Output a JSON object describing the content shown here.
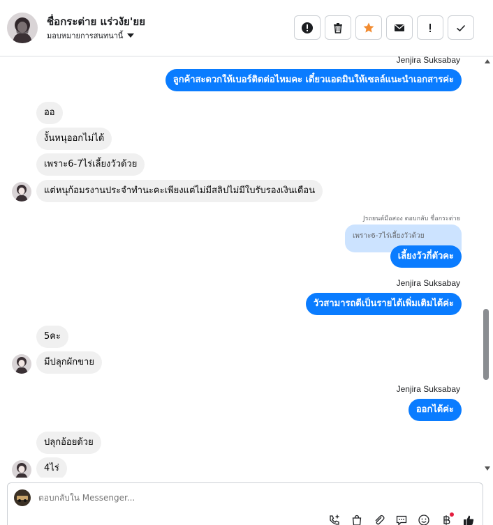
{
  "header": {
    "contact_name": "ชื่อกระต่าย แร่วงัย'ยย",
    "assign_label": "มอบหมายการสนทนานี้",
    "toolbar": [
      {
        "name": "mark-spam-button",
        "icon": "alert-circle-icon"
      },
      {
        "name": "delete-button",
        "icon": "trash-icon"
      },
      {
        "name": "star-button",
        "icon": "star-icon"
      },
      {
        "name": "mark-unread-button",
        "icon": "envelope-icon"
      },
      {
        "name": "follow-up-button",
        "icon": "exclamation-icon"
      },
      {
        "name": "mark-done-button",
        "icon": "check-icon"
      }
    ]
  },
  "messages": {
    "sender_name": "Jenjira Suksabay",
    "out1": "ลูกค้าสะดวกให้เบอร์ติดต่อไหมคะ เดี๋ยวแอดมินให้เซลล์แนะนำเอกสารค่ะ",
    "in1": "ออ",
    "in2": "งั้นหนุออกไม่ได้",
    "in3": "เพราะ6-7ไร่เลี้ยงวัวด้วย",
    "in4": "แต่หนุก้อมรงานประจำทำนะคะเพียงแต่ไม่มีสลิปไม่มีใบรับรองเงินเดือน",
    "reply_meta": "Jรถยนต์มือสอง ตอบกลับ ชื่อกระต่าย",
    "reply_quote": "เพราะ6-7ไร่เลี้ยงวัวด้วย",
    "out2": "เลี้ยงวัวกี่ตัวคะ",
    "out3": "วัวสามารถดีเป็นรายได้เพิ่มเติมได้ค่ะ",
    "in5": "5คะ",
    "in6": "มีปลุกผักขาย",
    "out4": "ออกได้ค่ะ",
    "in7": "ปลุกอ้อยด้วย",
    "in8": "4ไร่"
  },
  "composer": {
    "placeholder": "ตอบกลับใน Messenger..."
  },
  "colors": {
    "outgoing_bubble": "#0a7cff",
    "incoming_bubble": "#f0f0f0",
    "star": "#f28b30",
    "notification_dot": "#e41e3f"
  }
}
